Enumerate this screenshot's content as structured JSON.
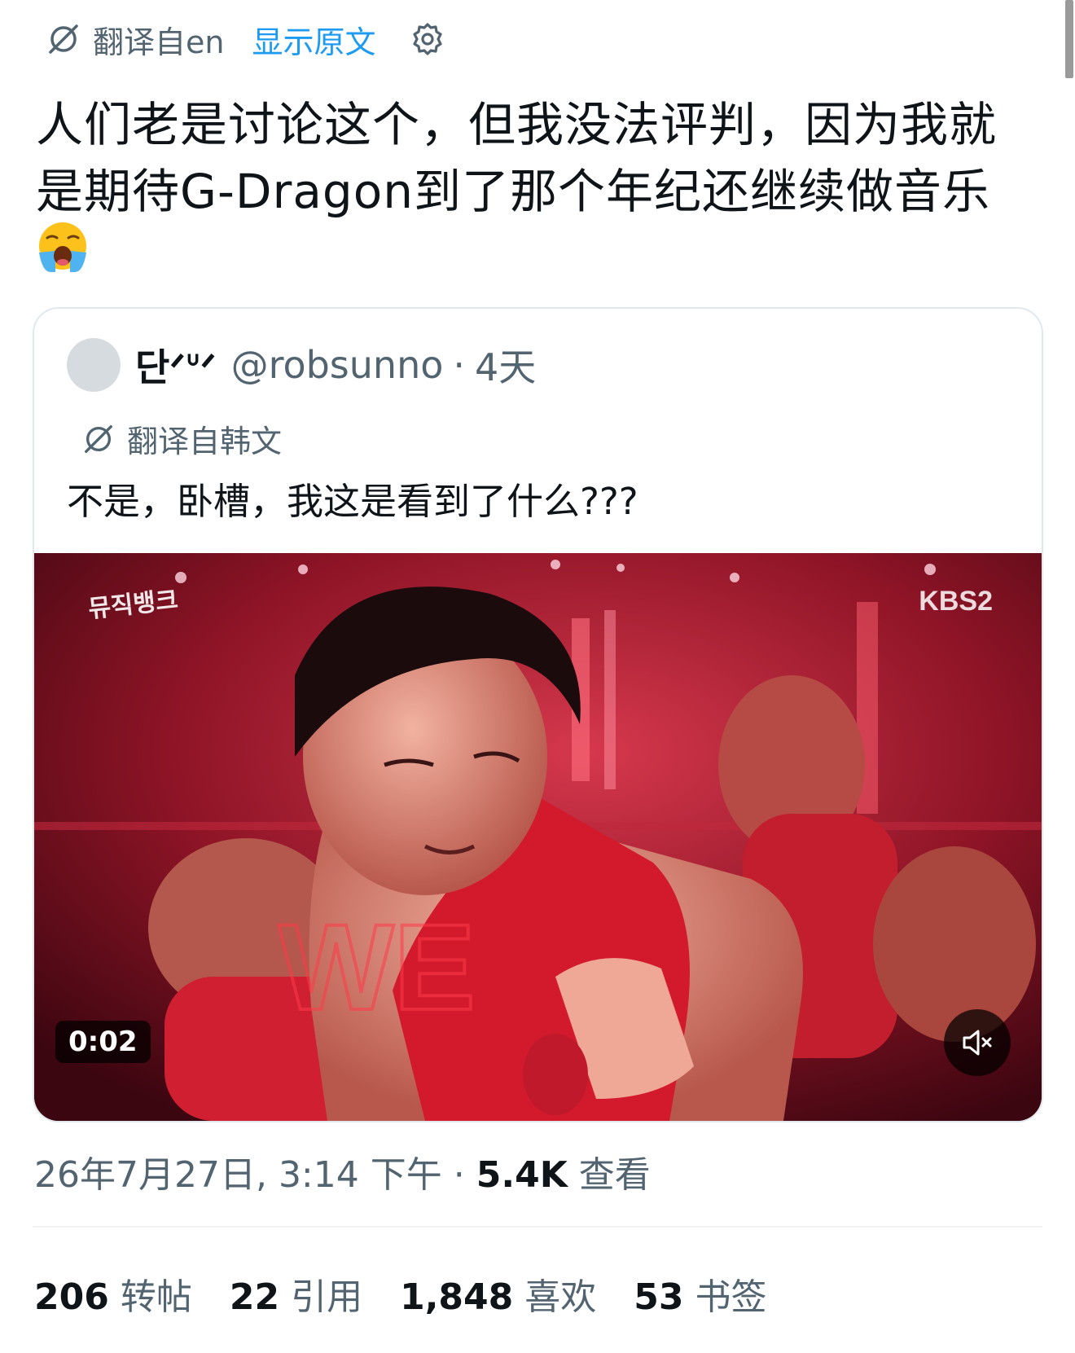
{
  "colors": {
    "accent": "#1d9bf0",
    "text_primary": "#0f1419",
    "text_secondary": "#536471",
    "border": "#e1e8ed"
  },
  "translate_bar": {
    "icon": "translate-icon",
    "label": "翻译自en",
    "show_original": "显示原文",
    "settings_icon": "gear-icon"
  },
  "tweet": {
    "text_line1": "人们老是讨论这个，但我没法评判，因为我就",
    "text_line2": "是期待G-Dragon到了那个年纪还继续做音乐",
    "emoji": "loudly-crying-face-emoji"
  },
  "quote": {
    "display_name": "단ᐟᐡᐟ",
    "handle": "@robsunno",
    "separator": "·",
    "time": "4天",
    "translate_label": "翻译自韩文",
    "text": "不是，卧槽，我这是看到了什么???",
    "video": {
      "duration": "0:02",
      "mute_icon": "muted-speaker-icon",
      "broadcaster_logo": "KBS2",
      "show_logo": "뮤직뱅크"
    }
  },
  "meta": {
    "datetime": "26年7月27日, 3:14 下午",
    "separator": "·",
    "views_count": "5.4K",
    "views_label": "查看"
  },
  "stats": [
    {
      "num": "206",
      "label": "转帖"
    },
    {
      "num": "22",
      "label": "引用"
    },
    {
      "num": "1,848",
      "label": "喜欢"
    },
    {
      "num": "53",
      "label": "书签"
    }
  ]
}
